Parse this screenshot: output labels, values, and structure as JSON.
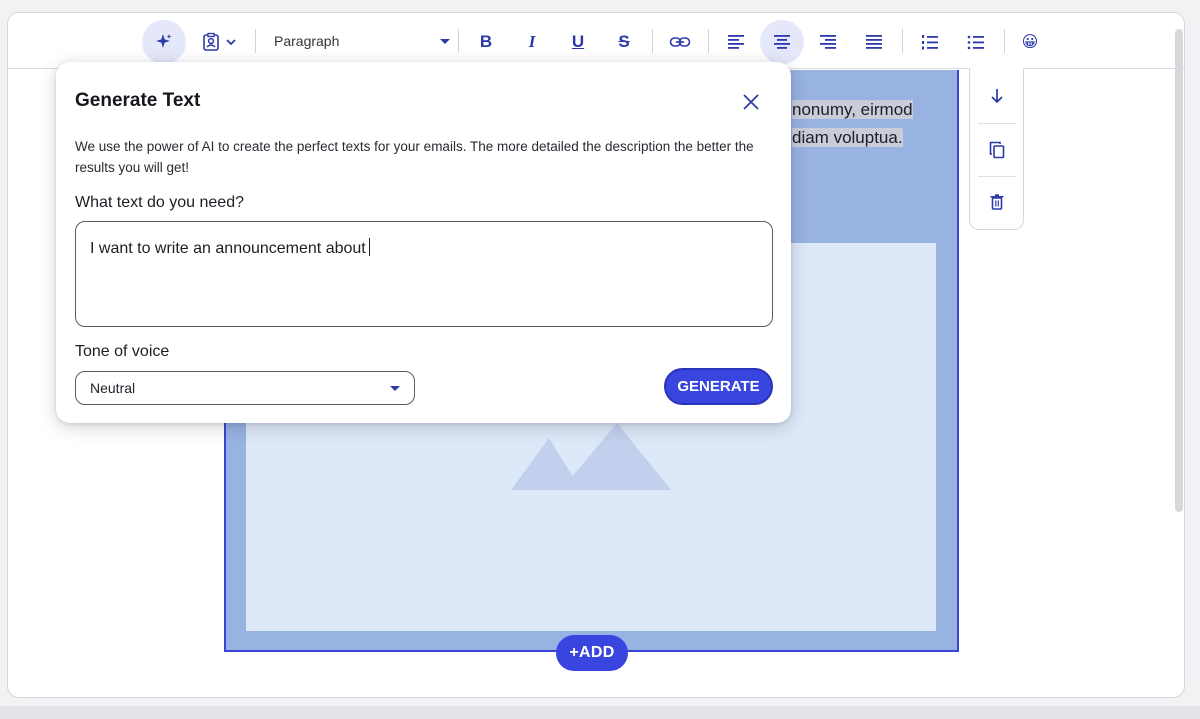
{
  "toolbar": {
    "paragraph_style": "Paragraph",
    "bold_label": "B",
    "italic_label": "I",
    "underline_label": "U",
    "strike_label": "S",
    "emoji": "😀",
    "icons": [
      "ai-sparkle-icon",
      "personalize-icon",
      "chevron-down-icon",
      "bold-icon",
      "italic-icon",
      "underline-icon",
      "strikethrough-icon",
      "link-icon",
      "align-left-icon",
      "align-center-icon",
      "align-right-icon",
      "align-justify-icon",
      "ordered-list-icon",
      "bullet-list-icon",
      "emoji-icon"
    ]
  },
  "canvas": {
    "block_text_line1": "nonumy, eirmod",
    "block_text_line2": "diam voluptua.",
    "add_button": "+ADD"
  },
  "side_tools": [
    "move-down-icon",
    "duplicate-icon",
    "delete-icon"
  ],
  "popup": {
    "title": "Generate Text",
    "description": "We use the power of AI to create the perfect texts for your emails. The more detailed the description the better the results you will get!",
    "prompt_label": "What text do you need?",
    "prompt_value": "I want to write an announcement about",
    "tone_label": "Tone of voice",
    "tone_value": "Neutral",
    "generate_label": "GENERATE"
  },
  "colors": {
    "accent": "#3845de",
    "icon": "#2b3aa8",
    "block_bg": "#98b2e2",
    "image_bg": "#dde8f8"
  }
}
